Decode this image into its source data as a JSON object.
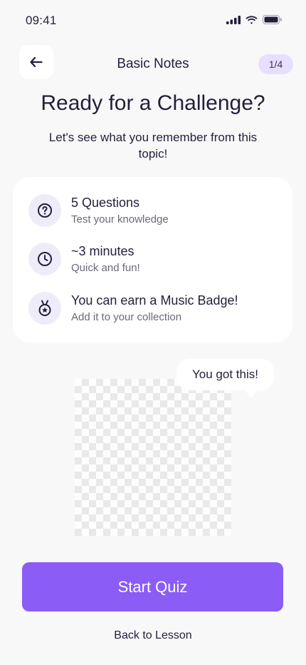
{
  "status_bar": {
    "time": "09:41",
    "icons": [
      "signal-icon",
      "wifi-icon",
      "battery-icon"
    ]
  },
  "header": {
    "back_icon": "arrow-left-icon",
    "title": "Basic Notes",
    "progress": "1/4"
  },
  "main": {
    "title": "Ready for a Challenge?",
    "subtitle": "Let's see what you remember from this topic!"
  },
  "info_card": {
    "items": [
      {
        "icon": "question-circle-icon",
        "title": "5 Questions",
        "subtitle": "Test your knowledge"
      },
      {
        "icon": "clock-icon",
        "title": "~3 minutes",
        "subtitle": "Quick and fun!"
      },
      {
        "icon": "medal-icon",
        "title": "You can earn a Music Badge!",
        "subtitle": "Add it to your collection"
      }
    ]
  },
  "mascot": {
    "speech": "You got this!"
  },
  "actions": {
    "start_label": "Start Quiz",
    "back_label": "Back to Lesson"
  },
  "colors": {
    "background": "#f8f8f9",
    "accent": "#8b5cf6",
    "text": "#231f3a",
    "pill": "#e8dfff"
  }
}
